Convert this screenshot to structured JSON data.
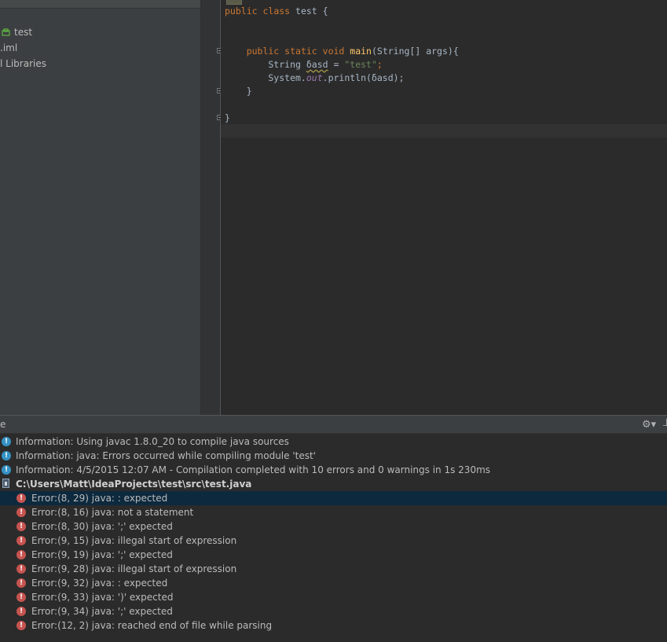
{
  "project_tree": {
    "items": [
      {
        "label": "test"
      },
      {
        "label": ".iml"
      },
      {
        "label": "l Libraries"
      }
    ]
  },
  "editor": {
    "lines": [
      {
        "parts": [
          {
            "t": "public ",
            "c": "kw"
          },
          {
            "t": "class ",
            "c": "kw"
          },
          {
            "t": "test {",
            "c": ""
          }
        ]
      },
      {
        "parts": [
          {
            "t": "    public ",
            "c": "kw"
          },
          {
            "t": "static ",
            "c": "kw"
          },
          {
            "t": "void ",
            "c": "kw"
          },
          {
            "t": "main",
            "c": "fn"
          },
          {
            "t": "(String[] args){",
            "c": ""
          }
        ]
      },
      {
        "parts": [
          {
            "t": "        String ",
            "c": ""
          },
          {
            "t": "δasd",
            "c": "warn"
          },
          {
            "t": " = ",
            "c": ""
          },
          {
            "t": "\"test\"",
            "c": "str"
          },
          {
            "t": ";",
            "c": "kw"
          }
        ]
      },
      {
        "parts": [
          {
            "t": "        System.",
            "c": ""
          },
          {
            "t": "out",
            "c": "field"
          },
          {
            "t": ".println(δasd);",
            "c": ""
          }
        ]
      },
      {
        "parts": [
          {
            "t": "    }",
            "c": ""
          }
        ]
      },
      {
        "parts": [
          {
            "t": "}",
            "c": ""
          }
        ]
      }
    ]
  },
  "messages": {
    "panel_title": "e",
    "gear_icon": "gear-icon",
    "info": [
      "Information: Using javac 1.8.0_20 to compile java sources",
      "Information: java: Errors occurred while compiling module 'test'",
      "Information: 4/5/2015 12:07 AM - Compilation completed with 10 errors and 0 warnings in 1s 230ms"
    ],
    "file_path": "C:\\Users\\Matt\\IdeaProjects\\test\\src\\test.java",
    "errors": [
      "Error:(8, 29)  java: : expected",
      "Error:(8, 16)  java: not a statement",
      "Error:(8, 30)  java: ';' expected",
      "Error:(9, 15)  java: illegal start of expression",
      "Error:(9, 19)  java: ';' expected",
      "Error:(9, 28)  java: illegal start of expression",
      "Error:(9, 32)  java: : expected",
      "Error:(9, 33)  java: ')' expected",
      "Error:(9, 34)  java: ';' expected",
      "Error:(12, 2)  java: reached end of file while parsing"
    ]
  }
}
